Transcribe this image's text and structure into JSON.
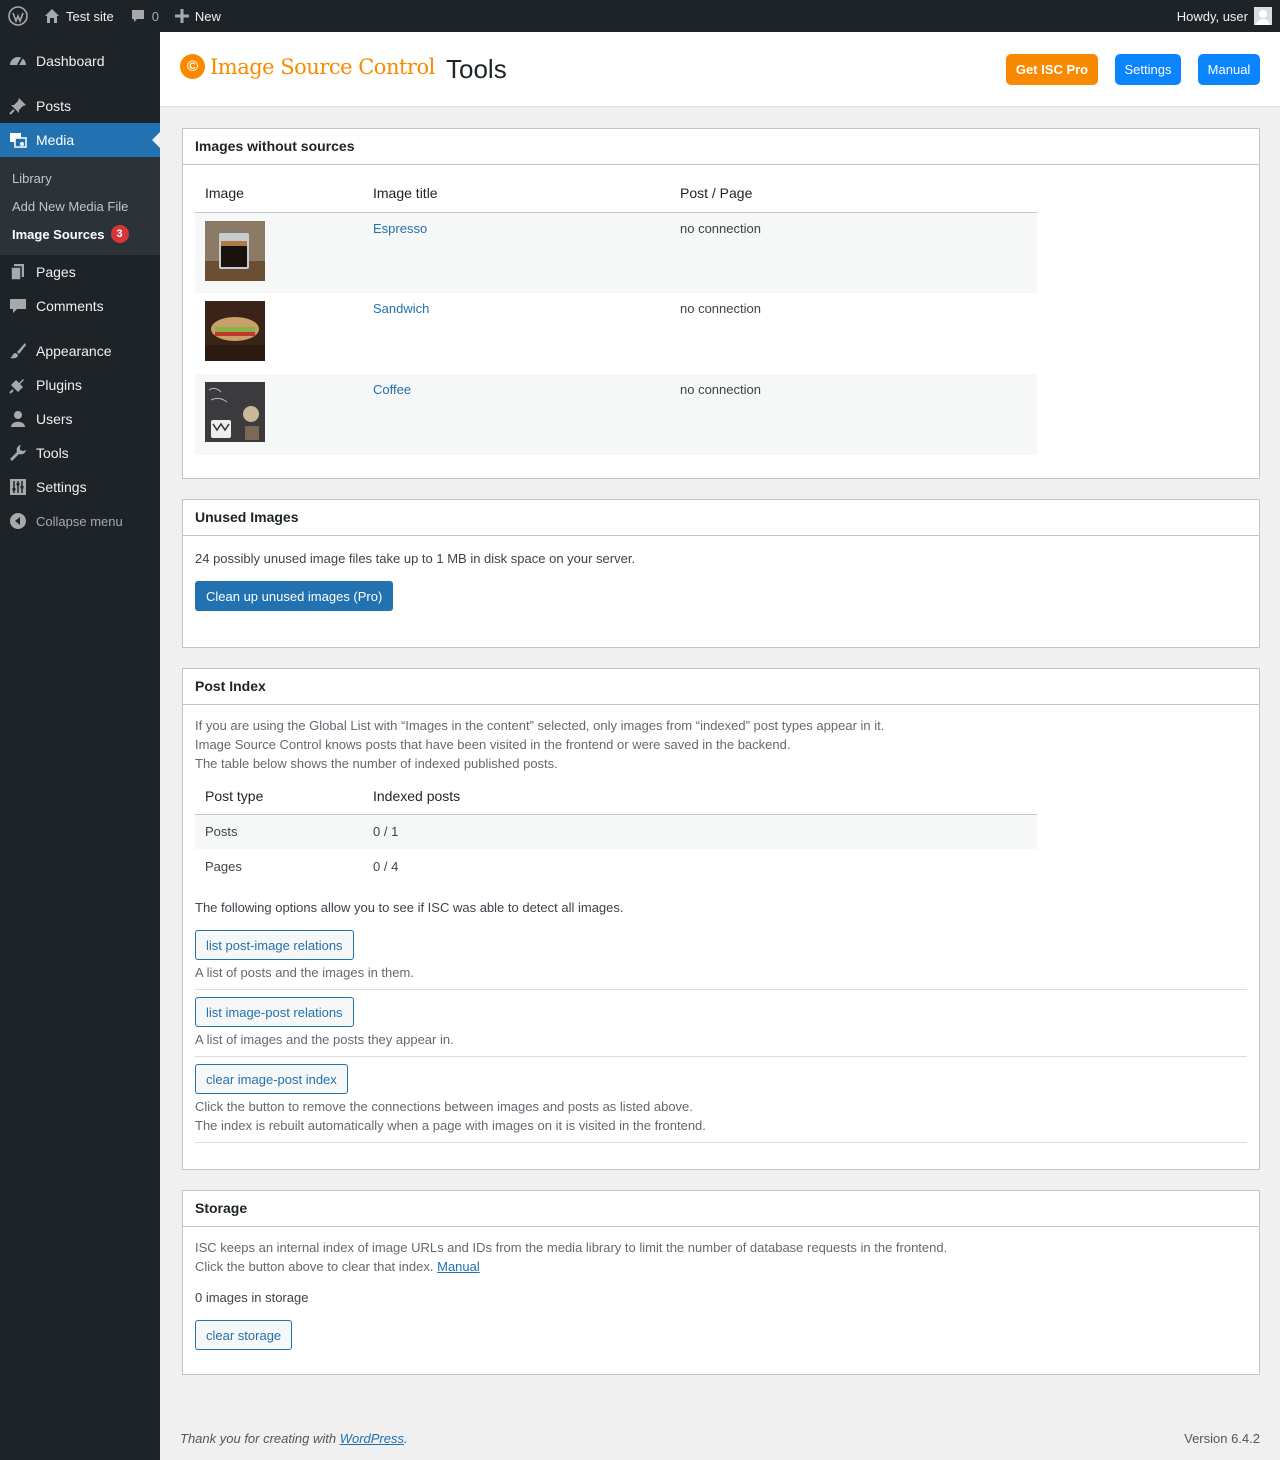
{
  "adminbar": {
    "site_name": "Test site",
    "comments_count": "0",
    "new_label": "New",
    "howdy": "Howdy, user"
  },
  "sidebar": {
    "items": [
      {
        "label": "Dashboard",
        "icon": "dashboard-icon"
      },
      {
        "label": "Posts",
        "icon": "pin-icon"
      },
      {
        "label": "Media",
        "icon": "media-icon"
      },
      {
        "label": "Pages",
        "icon": "pages-icon"
      },
      {
        "label": "Comments",
        "icon": "comments-icon"
      },
      {
        "label": "Appearance",
        "icon": "brush-icon"
      },
      {
        "label": "Plugins",
        "icon": "plugin-icon"
      },
      {
        "label": "Users",
        "icon": "users-icon"
      },
      {
        "label": "Tools",
        "icon": "wrench-icon"
      },
      {
        "label": "Settings",
        "icon": "settings-icon"
      }
    ],
    "submenu": [
      "Library",
      "Add New Media File",
      "Image Sources"
    ],
    "submenu_badge": "3",
    "collapse": "Collapse menu"
  },
  "header": {
    "logo_text": "Image Source Control",
    "title": "Tools",
    "buttons": {
      "pro": "Get ISC Pro",
      "settings": "Settings",
      "manual": "Manual"
    },
    "colors": {
      "brand": "#f98a00",
      "button_blue": "#0a84ff"
    }
  },
  "no_sources": {
    "title": "Images without sources",
    "columns": [
      "Image",
      "Image title",
      "Post / Page"
    ],
    "rows": [
      {
        "title": "Espresso",
        "post": "no connection"
      },
      {
        "title": "Sandwich",
        "post": "no connection"
      },
      {
        "title": "Coffee",
        "post": "no connection"
      }
    ]
  },
  "unused": {
    "title": "Unused Images",
    "text": "24 possibly unused image files take up to 1 MB in disk space on your server.",
    "button": "Clean up unused images (Pro)"
  },
  "post_index": {
    "title": "Post Index",
    "intro": [
      "If you are using the Global List with “Images in the content” selected, only images from “indexed” post types appear in it.",
      "Image Source Control knows posts that have been visited in the frontend or were saved in the backend.",
      "The table below shows the number of indexed published posts."
    ],
    "columns": [
      "Post type",
      "Indexed posts"
    ],
    "rows": [
      {
        "type": "Posts",
        "count": "0 / 1"
      },
      {
        "type": "Pages",
        "count": "0 / 4"
      }
    ],
    "options_text": "The following options allow you to see if ISC was able to detect all images.",
    "btn_post_image": "list post-image relations",
    "desc_post_image": "A list of posts and the images in them.",
    "btn_image_post": "list image-post relations",
    "desc_image_post": "A list of images and the posts they appear in.",
    "btn_clear": "clear image-post index",
    "desc_clear": [
      "Click the button to remove the connections between images and posts as listed above.",
      "The index is rebuilt automatically when a page with images on it is visited in the frontend."
    ]
  },
  "storage": {
    "title": "Storage",
    "line1": "ISC keeps an internal index of image URLs and IDs from the media library to limit the number of database requests in the frontend.",
    "line2": "Click the button above to clear that index.",
    "manual_link": "Manual",
    "count": "0 images in storage",
    "button": "clear storage"
  },
  "footer": {
    "thanks_prefix": "Thank you for creating with",
    "wordpress": "WordPress",
    "version": "Version 6.4.2"
  }
}
